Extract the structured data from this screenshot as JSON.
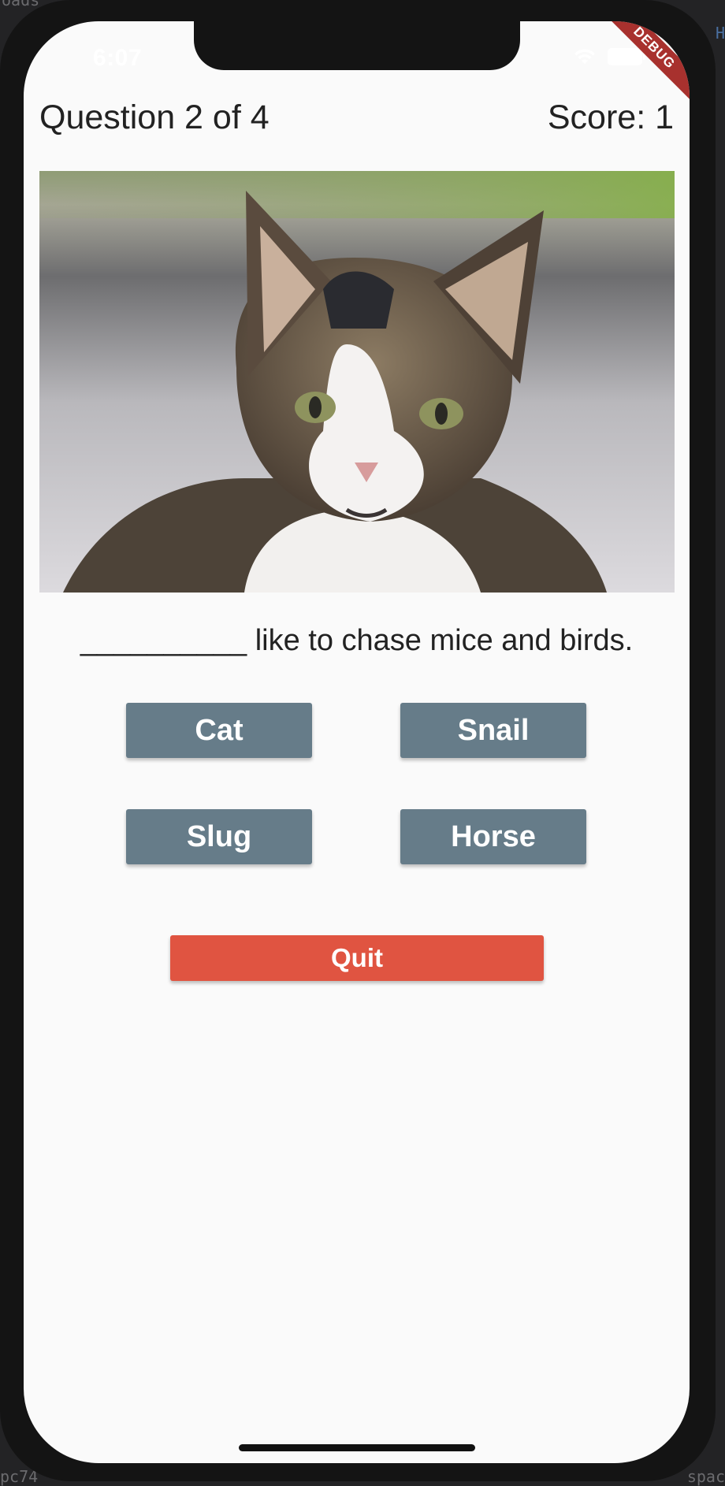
{
  "background": {
    "top_left": "oads",
    "top_right": "H",
    "bottom_left": "pc74",
    "bottom_right": "spac"
  },
  "status_bar": {
    "time": "6:07",
    "wifi_icon": "wifi-icon",
    "battery_icon": "battery-icon"
  },
  "debug_banner": "DEBUG",
  "header": {
    "question_progress": "Question 2 of 4",
    "score": "Score: 1"
  },
  "quiz": {
    "image_icon": "cat-photo",
    "question": "__________ like to chase mice and birds.",
    "answers": [
      "Cat",
      "Snail",
      "Slug",
      "Horse"
    ],
    "quit_label": "Quit"
  },
  "colors": {
    "answer_button": "#667c89",
    "quit_button": "#e05441",
    "screen_bg": "#fafafa"
  }
}
